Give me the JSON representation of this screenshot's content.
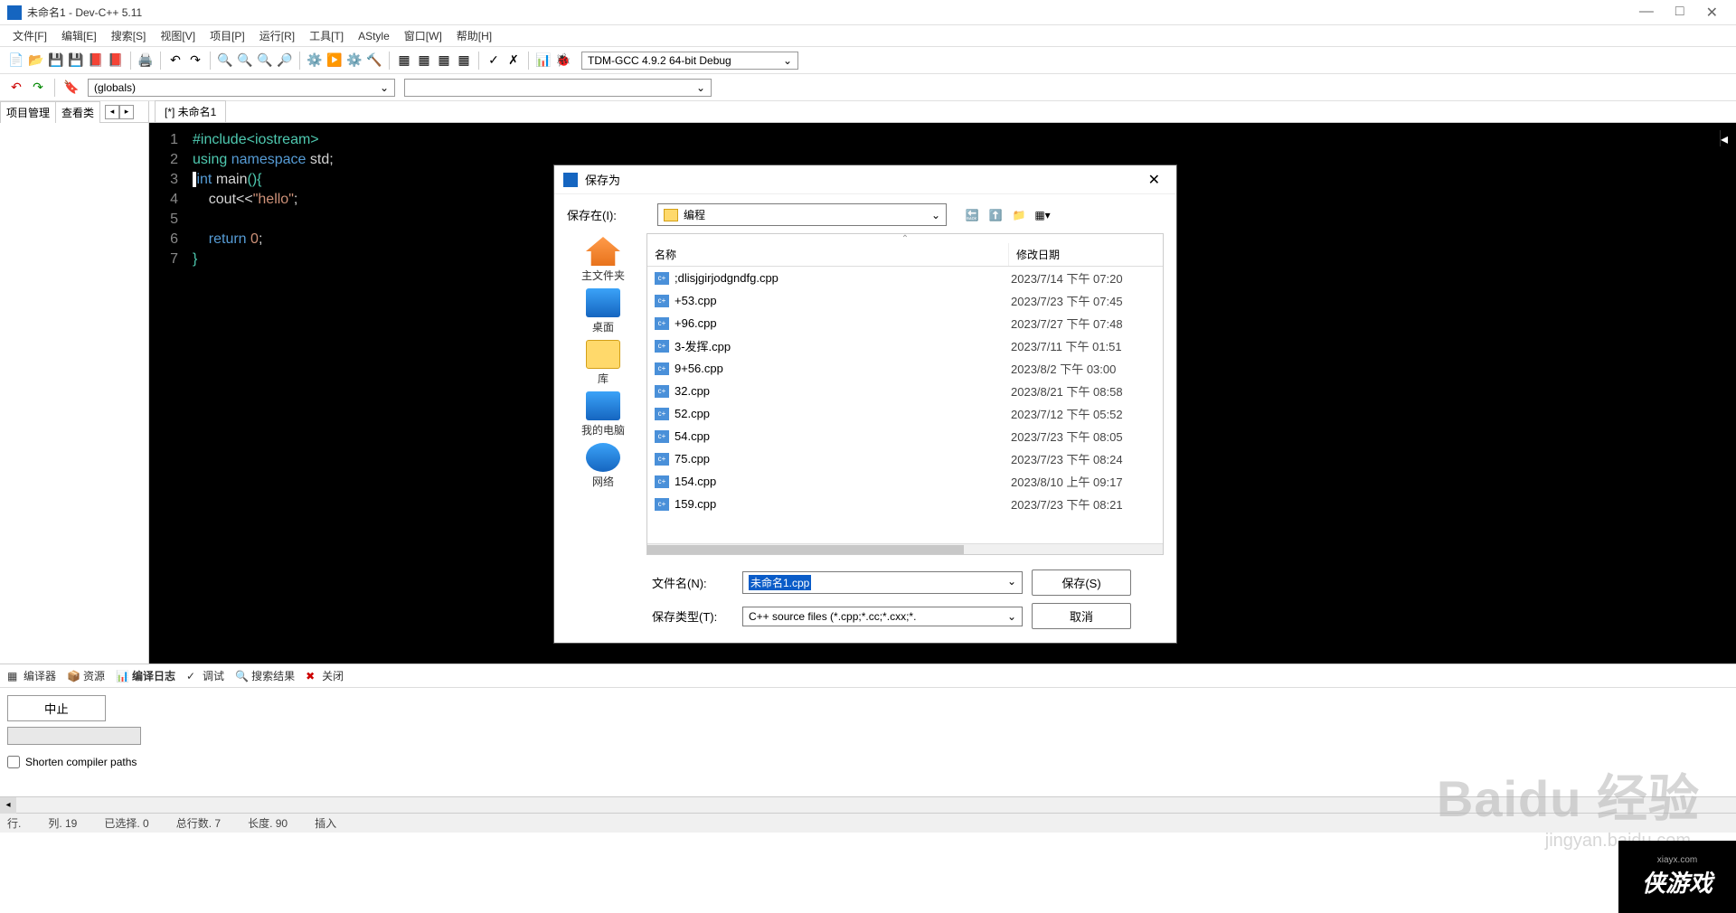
{
  "title": "未命名1 - Dev-C++ 5.11",
  "window_controls": {
    "min": "—",
    "max": "□",
    "close": "✕"
  },
  "menu": [
    "文件[F]",
    "编辑[E]",
    "搜索[S]",
    "视图[V]",
    "项目[P]",
    "运行[R]",
    "工具[T]",
    "AStyle",
    "窗口[W]",
    "帮助[H]"
  ],
  "compiler": "TDM-GCC 4.9.2 64-bit Debug",
  "globals": "(globals)",
  "sidebar_tabs": [
    "项目管理",
    "查看类"
  ],
  "editor_tab": "[*] 未命名1",
  "code_lines": [
    {
      "n": "1",
      "t": "#include<iostream>",
      "c": "kw-green"
    },
    {
      "n": "2",
      "t": "using namespace std;"
    },
    {
      "n": "3",
      "t": "int main(){"
    },
    {
      "n": "4",
      "t": "    cout<<\"hello\";"
    },
    {
      "n": "5",
      "t": ""
    },
    {
      "n": "6",
      "t": "    return 0;"
    },
    {
      "n": "7",
      "t": "}"
    }
  ],
  "bottom_tabs": [
    "编译器",
    "资源",
    "编译日志",
    "调试",
    "搜索结果",
    "关闭"
  ],
  "abort": "中止",
  "shorten": "Shorten compiler paths",
  "status": {
    "line": "行.",
    "col": "列. 19",
    "sel": "已选择. 0",
    "total": "总行数. 7",
    "len": "长度. 90",
    "ins": "插入"
  },
  "dialog": {
    "title": "保存为",
    "save_in_label": "保存在(I):",
    "folder": "编程",
    "headers": {
      "name": "名称",
      "date": "修改日期"
    },
    "places": [
      "主文件夹",
      "桌面",
      "库",
      "我的电脑",
      "网络"
    ],
    "files": [
      {
        "name": ";dlisjgirjodgndfg.cpp",
        "date": "2023/7/14 下午 07:20"
      },
      {
        "name": "+53.cpp",
        "date": "2023/7/23 下午 07:45"
      },
      {
        "name": "+96.cpp",
        "date": "2023/7/27 下午 07:48"
      },
      {
        "name": "3-发挥.cpp",
        "date": "2023/7/11 下午 01:51"
      },
      {
        "name": "9+56.cpp",
        "date": "2023/8/2 下午 03:00"
      },
      {
        "name": "32.cpp",
        "date": "2023/8/21 下午 08:58"
      },
      {
        "name": "52.cpp",
        "date": "2023/7/12 下午 05:52"
      },
      {
        "name": "54.cpp",
        "date": "2023/7/23 下午 08:05"
      },
      {
        "name": "75.cpp",
        "date": "2023/7/23 下午 08:24"
      },
      {
        "name": "154.cpp",
        "date": "2023/8/10 上午 09:17"
      },
      {
        "name": "159.cpp",
        "date": "2023/7/23 下午 08:21"
      }
    ],
    "filename_label": "文件名(N):",
    "filename": "未命名1.cpp",
    "filetype_label": "保存类型(T):",
    "filetype": "C++ source files (*.cpp;*.cc;*.cxx;*.",
    "save_btn": "保存(S)",
    "cancel_btn": "取消"
  },
  "watermark": {
    "main": "Baidu 经验",
    "sub": "jingyan.baidu.com",
    "corner_sub": "xiayx.com",
    "corner": "侠游戏"
  }
}
